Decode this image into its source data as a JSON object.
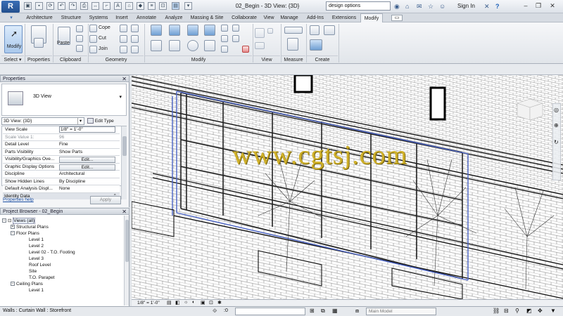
{
  "titlebar": {
    "app_letter": "R",
    "doc_title": "02_Begin - 3D View: {3D}",
    "search_text": "design options",
    "signin": "Sign In",
    "help": "?"
  },
  "tabs": [
    "Architecture",
    "Structure",
    "Systems",
    "Insert",
    "Annotate",
    "Analyze",
    "Massing & Site",
    "Collaborate",
    "View",
    "Manage",
    "Add-Ins",
    "Extensions",
    "Modify"
  ],
  "active_tab": "Modify",
  "ribbon": {
    "modify_label": "Modify",
    "properties_label": "Properties",
    "paste_label": "Paste",
    "cope_label": "Cope",
    "cut_label": "Cut",
    "join_label": "Join",
    "panels": {
      "select": "Select",
      "properties": "Properties",
      "clipboard": "Clipboard",
      "geometry": "Geometry",
      "modify": "Modify",
      "view": "View",
      "measure": "Measure",
      "create": "Create"
    }
  },
  "properties": {
    "header": "Properties",
    "type_name": "3D View",
    "selector_value": "3D View: {3D}",
    "edit_type": "Edit Type",
    "rows": [
      {
        "name": "View Scale",
        "value": "1/8\" = 1'-0\""
      },
      {
        "name": "Scale Value   1:",
        "value": "96"
      },
      {
        "name": "Detail Level",
        "value": "Fine"
      },
      {
        "name": "Parts Visibility",
        "value": "Show Parts"
      },
      {
        "name": "Visibility/Graphics Ove...",
        "value": "Edit..."
      },
      {
        "name": "Graphic Display Options",
        "value": "Edit..."
      },
      {
        "name": "Discipline",
        "value": "Architectural"
      },
      {
        "name": "Show Hidden Lines",
        "value": "By Discipline"
      },
      {
        "name": "Default Analysis Displ...",
        "value": "None"
      }
    ],
    "section": "Identity Data",
    "help_link": "Properties help",
    "apply": "Apply"
  },
  "browser": {
    "header": "Project Browser - 02_Begin",
    "items": [
      {
        "label": "Views (all)",
        "level": 0,
        "box": "-"
      },
      {
        "label": "Structural Plans",
        "level": 1,
        "box": "+"
      },
      {
        "label": "Floor Plans",
        "level": 1,
        "box": "-"
      },
      {
        "label": "Level 1",
        "level": 2,
        "box": ""
      },
      {
        "label": "Level 2",
        "level": 2,
        "box": ""
      },
      {
        "label": "Level 02 - T.O. Footing",
        "level": 2,
        "box": ""
      },
      {
        "label": "Level 3",
        "level": 2,
        "box": ""
      },
      {
        "label": "Roof Level",
        "level": 2,
        "box": ""
      },
      {
        "label": "Site",
        "level": 2,
        "box": ""
      },
      {
        "label": "T.O. Parapet",
        "level": 2,
        "box": ""
      },
      {
        "label": "Ceiling Plans",
        "level": 1,
        "box": "-"
      },
      {
        "label": "Level 1",
        "level": 2,
        "box": ""
      }
    ]
  },
  "view": {
    "scale_label": "1/8\" = 1'-0\"",
    "watermark": "www.cgtsj.com"
  },
  "status": {
    "text": "Walls : Curtain Wall : Storefront",
    "count": ":0",
    "model": "Main Model"
  },
  "colors": {
    "accent": "#3a6fb6",
    "selection": "#4a63c4"
  }
}
